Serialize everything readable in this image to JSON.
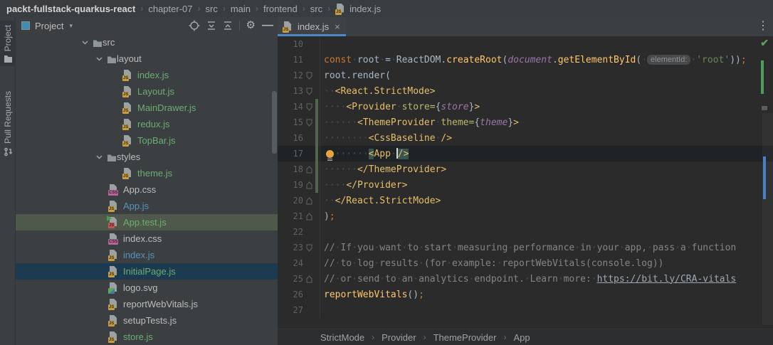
{
  "colors": {
    "accent_tab_underline": "#4A88C7",
    "vcs_added_gutter_green": "#50684A",
    "file_added_green": "#6CAC73",
    "file_modified_blue": "#5693BD",
    "tree_selection_active_bg": "#1C3A50",
    "tree_selection_inactive_bg": "#4F594B",
    "editor_bg": "#2B2B2B",
    "panel_bg": "#3C3F41"
  },
  "title_bar": {
    "separator": "›",
    "segments": [
      "packt-fullstack-quarkus-react",
      "chapter-07",
      "src",
      "main",
      "frontend",
      "src",
      "index.js"
    ]
  },
  "tool_stripe": {
    "project_label": "Project",
    "pull_requests_label": "Pull Requests"
  },
  "project_panel": {
    "header": {
      "title": "Project",
      "caret": "▾",
      "gear": "⚙",
      "minimize": "—"
    },
    "tree": [
      {
        "label": "src",
        "kind": "folder",
        "level": 0,
        "chevron": true
      },
      {
        "label": "layout",
        "kind": "folder",
        "level": 1,
        "chevron": true
      },
      {
        "label": "index.js",
        "kind": "js",
        "level": 2,
        "color": "green"
      },
      {
        "label": "Layout.js",
        "kind": "js",
        "level": 2,
        "color": "green"
      },
      {
        "label": "MainDrawer.js",
        "kind": "js",
        "level": 2,
        "color": "green"
      },
      {
        "label": "redux.js",
        "kind": "js",
        "level": 2,
        "color": "green"
      },
      {
        "label": "TopBar.js",
        "kind": "js",
        "level": 2,
        "color": "green"
      },
      {
        "label": "styles",
        "kind": "folder",
        "level": 1,
        "chevron": true
      },
      {
        "label": "theme.js",
        "kind": "js",
        "level": 2,
        "color": "green"
      },
      {
        "label": "App.css",
        "kind": "css",
        "level": 1
      },
      {
        "label": "App.js",
        "kind": "js",
        "level": 1,
        "color": "blue"
      },
      {
        "label": "App.test.js",
        "kind": "js-test",
        "level": 1,
        "color": "green",
        "selected": "inactive"
      },
      {
        "label": "index.css",
        "kind": "css",
        "level": 1
      },
      {
        "label": "index.js",
        "kind": "js",
        "level": 1,
        "color": "blue"
      },
      {
        "label": "InitialPage.js",
        "kind": "js",
        "level": 1,
        "color": "green",
        "selected": "active"
      },
      {
        "label": "logo.svg",
        "kind": "svg",
        "level": 1
      },
      {
        "label": "reportWebVitals.js",
        "kind": "js",
        "level": 1
      },
      {
        "label": "setupTests.js",
        "kind": "js",
        "level": 1
      },
      {
        "label": "store.js",
        "kind": "js",
        "level": 1,
        "color": "green"
      }
    ]
  },
  "editor": {
    "tab": {
      "label": "index.js",
      "close": "×"
    },
    "more_menu": "⋮",
    "inspection_check": "✔",
    "lines": [
      {
        "n": 10,
        "tokens": []
      },
      {
        "n": 11,
        "tokens": [
          [
            "kw",
            "const"
          ],
          [
            "pl",
            " root = ReactDOM."
          ],
          [
            "fn",
            "createRoot"
          ],
          [
            "pl",
            "("
          ],
          [
            "gl",
            "document"
          ],
          [
            "pl",
            "."
          ],
          [
            "fn",
            "getElementById"
          ],
          [
            "pl",
            "( "
          ],
          [
            "hint",
            "elementId:"
          ],
          [
            "pl",
            " "
          ],
          [
            "str",
            "'root'"
          ],
          [
            "pl",
            "))"
          ],
          [
            "sem",
            ";"
          ]
        ]
      },
      {
        "n": 12,
        "fold": "down",
        "tokens": [
          [
            "pl",
            "root.render("
          ]
        ]
      },
      {
        "n": 13,
        "fold": "down",
        "tokens": [
          [
            "pl",
            "  "
          ],
          [
            "tag",
            "<React.StrictMode>"
          ]
        ]
      },
      {
        "n": 14,
        "fold": "down",
        "vcs": true,
        "tokens": [
          [
            "pl",
            "    "
          ],
          [
            "tag",
            "<Provider"
          ],
          [
            "pl",
            " "
          ],
          [
            "attr",
            "store="
          ],
          [
            "pl",
            "{"
          ],
          [
            "gl",
            "store"
          ],
          [
            "pl",
            "}"
          ],
          [
            "tag",
            ">"
          ]
        ]
      },
      {
        "n": 15,
        "fold": "down",
        "vcs": true,
        "tokens": [
          [
            "pl",
            "      "
          ],
          [
            "tag",
            "<ThemeProvider"
          ],
          [
            "pl",
            " "
          ],
          [
            "attr",
            "theme="
          ],
          [
            "pl",
            "{"
          ],
          [
            "gl",
            "theme"
          ],
          [
            "pl",
            "}"
          ],
          [
            "tag",
            ">"
          ]
        ]
      },
      {
        "n": 16,
        "vcs": true,
        "tokens": [
          [
            "pl",
            "        "
          ],
          [
            "tag",
            "<CssBaseline />"
          ]
        ]
      },
      {
        "n": 17,
        "vcs": true,
        "cur": true,
        "bulb": true,
        "tokens": [
          [
            "pl",
            "        "
          ],
          [
            "taghl",
            "<"
          ],
          [
            "tag",
            "App"
          ],
          [
            "pl",
            " "
          ],
          [
            "caret",
            ""
          ],
          [
            "taghl",
            "/>"
          ]
        ]
      },
      {
        "n": 18,
        "fold": "up",
        "vcs": true,
        "tokens": [
          [
            "pl",
            "      "
          ],
          [
            "tag",
            "</ThemeProvider>"
          ]
        ]
      },
      {
        "n": 19,
        "fold": "up",
        "vcs": true,
        "tokens": [
          [
            "pl",
            "    "
          ],
          [
            "tag",
            "</Provider>"
          ]
        ]
      },
      {
        "n": 20,
        "fold": "up",
        "tokens": [
          [
            "pl",
            "  "
          ],
          [
            "tag",
            "</React.StrictMode>"
          ]
        ]
      },
      {
        "n": 21,
        "fold": "up",
        "tokens": [
          [
            "pl",
            ")"
          ],
          [
            "sem",
            ";"
          ]
        ]
      },
      {
        "n": 22,
        "tokens": []
      },
      {
        "n": 23,
        "fold": "down",
        "tokens": [
          [
            "cm",
            "// If you want to start measuring performance in your app, pass a function"
          ]
        ]
      },
      {
        "n": 24,
        "tokens": [
          [
            "cm",
            "// to log results (for example: reportWebVitals(console.log))"
          ]
        ]
      },
      {
        "n": 25,
        "fold": "up",
        "tokens": [
          [
            "cm",
            "// or send to an analytics endpoint. Learn more: "
          ],
          [
            "cml",
            "https://bit.ly/CRA-vitals"
          ]
        ]
      },
      {
        "n": 26,
        "tokens": [
          [
            "fn",
            "reportWebVitals"
          ],
          [
            "pl",
            "()"
          ],
          [
            "sem",
            ";"
          ]
        ]
      },
      {
        "n": 27,
        "tokens": []
      }
    ],
    "breadcrumbs": {
      "separator": "›",
      "items": [
        "StrictMode",
        "Provider",
        "ThemeProvider",
        "App"
      ]
    }
  }
}
